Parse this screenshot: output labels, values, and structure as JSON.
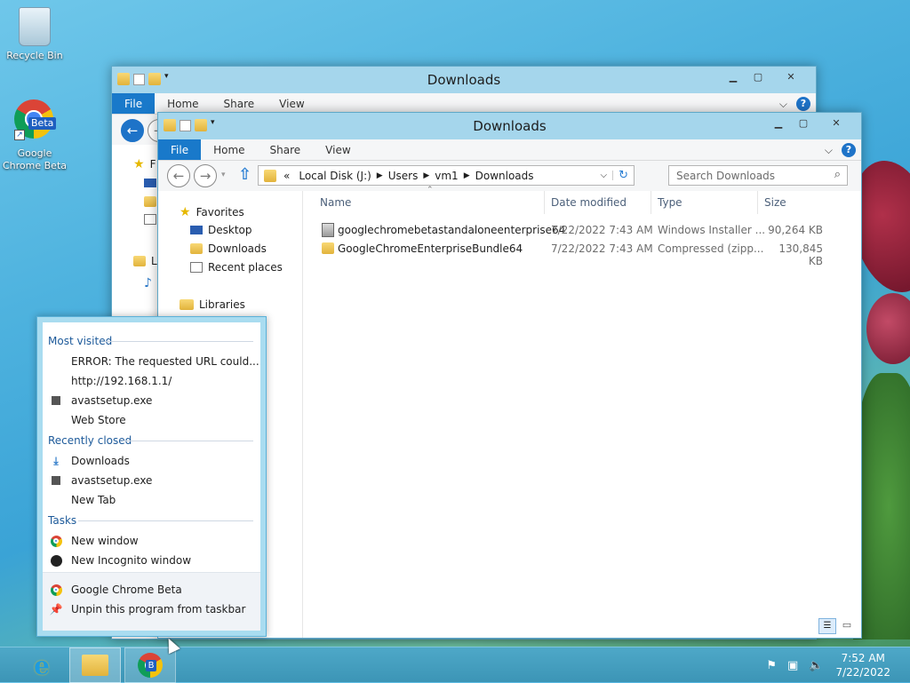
{
  "desktop": {
    "icons": [
      {
        "label": "Recycle Bin"
      },
      {
        "label": "Google Chrome Beta"
      }
    ]
  },
  "back_window": {
    "title": "Downloads",
    "tabs": [
      "File",
      "Home",
      "Share",
      "View"
    ],
    "nav_partial": [
      "F",
      "L"
    ]
  },
  "window": {
    "title": "Downloads",
    "tabs": [
      "File",
      "Home",
      "Share",
      "View"
    ],
    "address": {
      "overflow": "«",
      "segments": [
        "Local Disk (J:)",
        "Users",
        "vm1",
        "Downloads"
      ]
    },
    "search_placeholder": "Search Downloads",
    "nav": {
      "favorites": "Favorites",
      "items": [
        "Desktop",
        "Downloads",
        "Recent places"
      ],
      "libraries": "Libraries"
    },
    "columns": [
      "Name",
      "Date modified",
      "Type",
      "Size"
    ],
    "files": [
      {
        "name": "googlechromebetastandaloneenterprise64",
        "date": "7/22/2022 7:43 AM",
        "type": "Windows Installer ...",
        "size": "90,264 KB"
      },
      {
        "name": "GoogleChromeEnterpriseBundle64",
        "date": "7/22/2022 7:43 AM",
        "type": "Compressed (zipp...",
        "size": "130,845 KB"
      }
    ]
  },
  "jumplist": {
    "most_visited_header": "Most visited",
    "most_visited": [
      "ERROR: The requested URL could...",
      "http://192.168.1.1/",
      "avastsetup.exe",
      "Web Store"
    ],
    "recently_closed_header": "Recently closed",
    "recently_closed": [
      "Downloads",
      "avastsetup.exe",
      "New Tab"
    ],
    "tasks_header": "Tasks",
    "tasks": [
      "New window",
      "New Incognito window"
    ],
    "footer": [
      "Google Chrome Beta",
      "Unpin this program from taskbar"
    ]
  },
  "chrome_badge": "Beta",
  "taskbar_badge": "B",
  "taskbar": {
    "time": "7:52 AM",
    "date": "7/22/2022"
  }
}
